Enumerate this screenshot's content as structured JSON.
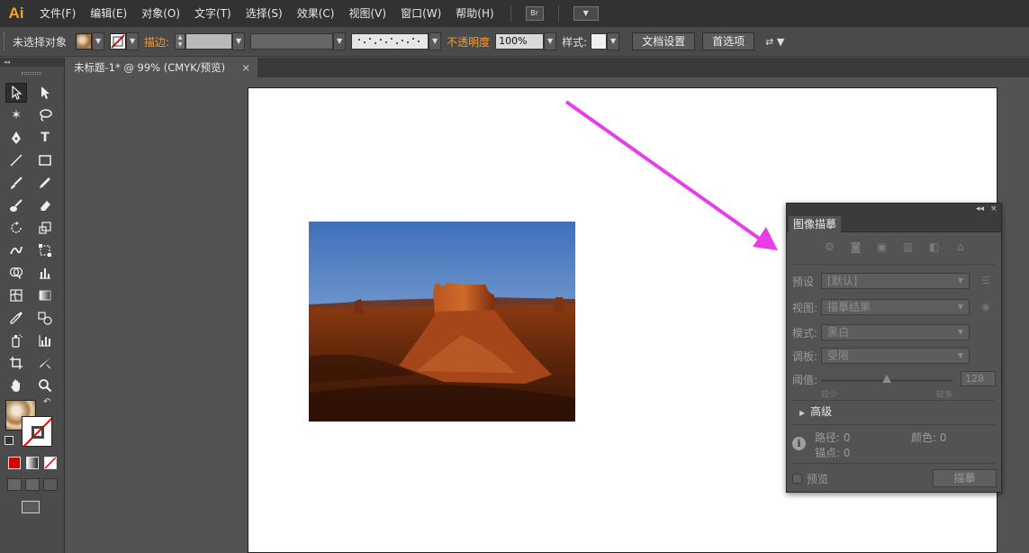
{
  "app": {
    "logo": "Ai"
  },
  "menu": [
    "文件(F)",
    "编辑(E)",
    "对象(O)",
    "文字(T)",
    "选择(S)",
    "效果(C)",
    "视图(V)",
    "窗口(W)",
    "帮助(H)"
  ],
  "menubar_buttons": {
    "bridge": "Br",
    "arrange": "▼"
  },
  "control": {
    "selection": "未选择对象",
    "stroke_label": "描边:",
    "opacity_label": "不透明度",
    "opacity_value": "100%",
    "style_label": "样式:",
    "doc_setup": "文档设置",
    "preferences": "首选项"
  },
  "document": {
    "tab_title": "未标题-1* @ 99% (CMYK/预览)",
    "close": "×"
  },
  "trace_panel": {
    "title": "图像描摹",
    "controls": {
      "collapse": "◂◂",
      "close": "×"
    },
    "preset_label": "预设",
    "preset_value": "[默认]",
    "view_label": "视图:",
    "view_value": "描摹结果",
    "mode_label": "模式:",
    "mode_value": "黑白",
    "palette_label": "调板:",
    "palette_value": "受限",
    "threshold_label": "阈值:",
    "threshold_value": "128",
    "threshold_fraction": 0.5,
    "less": "较少",
    "more": "较多",
    "advanced": "高级",
    "paths": "路径: 0",
    "colors": "颜色: 0",
    "anchors": "锚点: 0",
    "preview": "预览",
    "trace_button": "描摹"
  },
  "colors": {
    "arrow": "#e83ee8",
    "accent": "#f39c33"
  }
}
